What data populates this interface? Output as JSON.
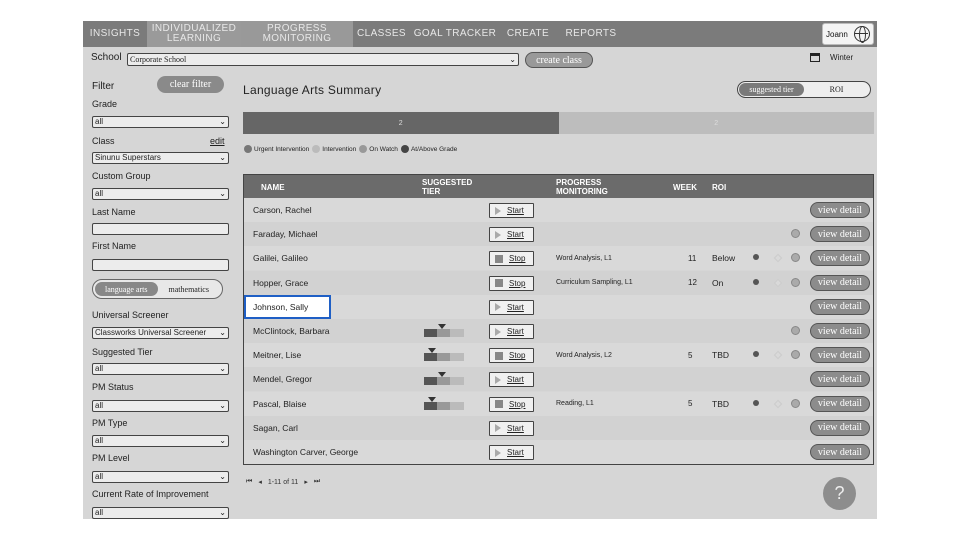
{
  "nav": {
    "items": [
      {
        "label": "INSIGHTS"
      },
      {
        "label": "INDIVIDUALIZED",
        "label2": "LEARNING"
      },
      {
        "label": "PROGRESS",
        "label2": "MONITORING"
      },
      {
        "label": "CLASSES"
      },
      {
        "label": "GOAL TRACKER"
      },
      {
        "label": "CREATE"
      },
      {
        "label": "REPORTS"
      }
    ],
    "user": "Joann"
  },
  "school": {
    "label": "School",
    "value": "Corporate School",
    "create_label": "create class",
    "term": "Winter"
  },
  "sidebar": {
    "filter_label": "Filter",
    "clear_label": "clear filter",
    "grade_label": "Grade",
    "grade_value": "all",
    "class_label": "Class",
    "class_edit": "edit",
    "class_value": "Sinunu Superstars",
    "custom_group_label": "Custom Group",
    "custom_group_value": "all",
    "last_name_label": "Last Name",
    "first_name_label": "First Name",
    "subject_la": "language arts",
    "subject_math": "mathematics",
    "screener_label": "Universal Screener",
    "screener_value": "Classworks Universal Screener",
    "suggested_tier_label": "Suggested Tier",
    "suggested_tier_value": "all",
    "pm_status_label": "PM Status",
    "pm_status_value": "all",
    "pm_type_label": "PM Type",
    "pm_type_value": "all",
    "pm_level_label": "PM Level",
    "pm_level_value": "all",
    "roi_label": "Current Rate of Improvement",
    "roi_value": "all"
  },
  "main": {
    "title": "Language Arts Summary",
    "toggle_tier": "suggested tier",
    "toggle_roi": "ROI",
    "distribution": [
      {
        "label": "2",
        "fraction": 0.5,
        "color": "#666666"
      },
      {
        "label": "2",
        "fraction": 0.5,
        "color": "#bdbdbd"
      }
    ],
    "legend": [
      {
        "label": "Urgent Intervention",
        "color": "#777777"
      },
      {
        "label": "Intervention",
        "color": "#bbbbbb"
      },
      {
        "label": "On Watch",
        "color": "#999999"
      },
      {
        "label": "At/Above Grade",
        "color": "#444444"
      }
    ]
  },
  "table": {
    "headers": {
      "name": "NAME",
      "tier1": "SUGGESTED",
      "tier2": "TIER",
      "pm1": "PROGRESS",
      "pm2": "MONITORING",
      "week": "WEEK",
      "roi": "ROI"
    },
    "view_label": "view detail",
    "rows": [
      {
        "name": "Carson, Rachel",
        "action": "Start",
        "pm": "",
        "week": "",
        "roi": "",
        "tier": false,
        "marks": false,
        "circle": false
      },
      {
        "name": "Faraday, Michael",
        "action": "Start",
        "pm": "",
        "week": "",
        "roi": "",
        "tier": false,
        "marks": false,
        "circle": true
      },
      {
        "name": "Galilei, Galileo",
        "action": "Stop",
        "pm": "Word Analysis, L1",
        "week": "11",
        "roi": "Below",
        "tier": false,
        "marks": true,
        "circle": true
      },
      {
        "name": "Hopper, Grace",
        "action": "Stop",
        "pm": "Curriculum Sampling, L1",
        "week": "12",
        "roi": "On",
        "tier": false,
        "marks": true,
        "circle": true
      },
      {
        "name": "Johnson, Sally",
        "action": "Start",
        "pm": "",
        "week": "",
        "roi": "",
        "tier": false,
        "marks": false,
        "circle": false,
        "highlight": true
      },
      {
        "name": "McClintock, Barbara",
        "action": "Start",
        "pm": "",
        "week": "",
        "roi": "",
        "tier": true,
        "tierpos": 0.35,
        "marks": false,
        "circle": true
      },
      {
        "name": "Meitner, Lise",
        "action": "Stop",
        "pm": "Word Analysis, L2",
        "week": "5",
        "roi": "TBD",
        "tier": true,
        "tierpos": 0.1,
        "marks": true,
        "circle": true
      },
      {
        "name": "Mendel, Gregor",
        "action": "Start",
        "pm": "",
        "week": "",
        "roi": "",
        "tier": true,
        "tierpos": 0.35,
        "marks": false,
        "circle": false
      },
      {
        "name": "Pascal, Blaise",
        "action": "Stop",
        "pm": "Reading, L1",
        "week": "5",
        "roi": "TBD",
        "tier": true,
        "tierpos": 0.1,
        "marks": true,
        "circle": true
      },
      {
        "name": "Sagan, Carl",
        "action": "Start",
        "pm": "",
        "week": "",
        "roi": "",
        "tier": false,
        "marks": false,
        "circle": false
      },
      {
        "name": "Washington Carver, George",
        "action": "Start",
        "pm": "",
        "week": "",
        "roi": "",
        "tier": false,
        "marks": false,
        "circle": false
      }
    ]
  },
  "pager": {
    "text": "1-11 of 11"
  },
  "help_label": "?"
}
